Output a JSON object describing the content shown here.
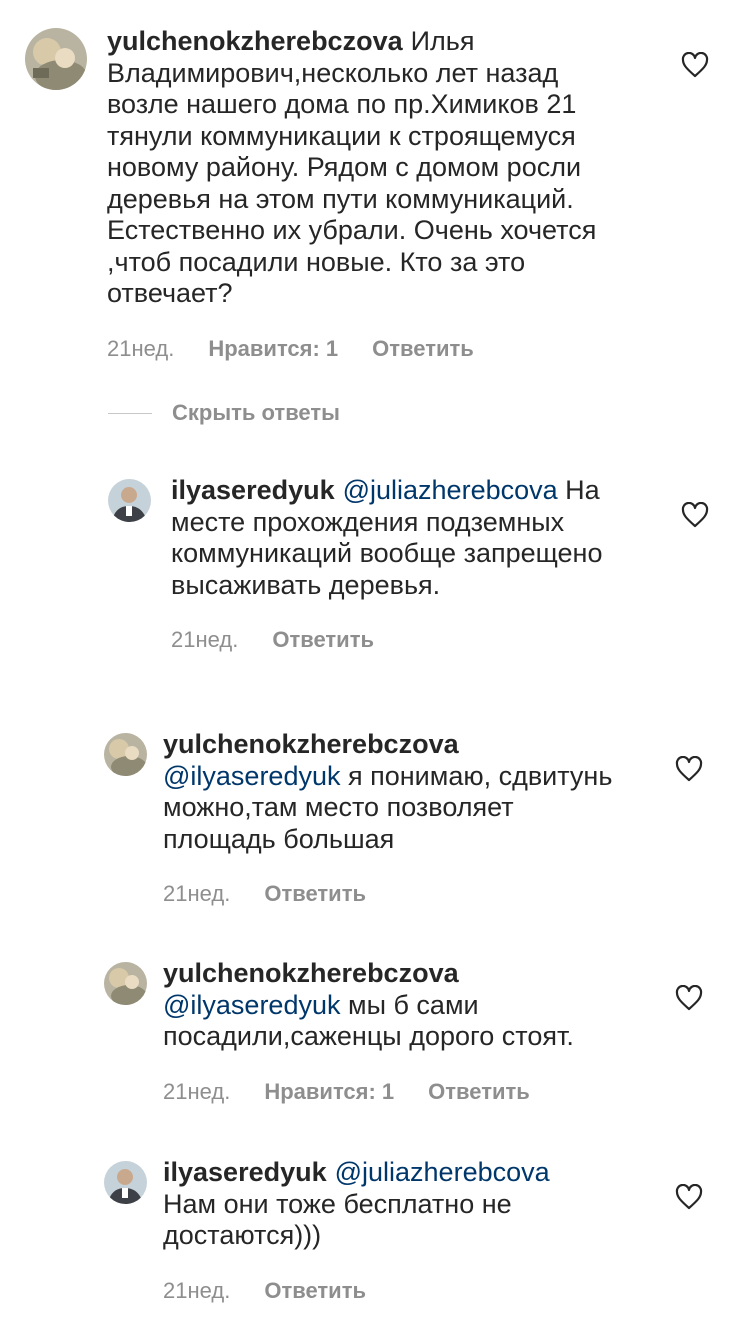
{
  "comment": {
    "username": "yulchenokzherebczova",
    "text": "Илья Владимирович,несколько лет назад возле нашего дома по пр.Химиков 21 тянули коммуникации к строящемуся новому району. Рядом с домом росли деревья на этом пути коммуникаций. Естественно их убрали. Очень хочется ,чтоб посадили новые. Кто за это отвечает?",
    "time": "21нед.",
    "likes": "Нравится: 1",
    "reply": "Ответить"
  },
  "hide_replies_label": "Скрыть ответы",
  "replies": [
    {
      "username": "ilyaseredyuk",
      "mention": "@juliazherebcova",
      "text": "На месте прохождения подземных коммуникаций вообще запрещено высаживать деревья.",
      "time": "21нед.",
      "likes": "",
      "reply": "Ответить"
    },
    {
      "username": "yulchenokzherebczova",
      "mention": "@ilyaseredyuk",
      "text": "я понимаю, сдвитунь можно,там место позволяет площадь большая",
      "time": "21нед.",
      "likes": "",
      "reply": "Ответить"
    },
    {
      "username": "yulchenokzherebczova",
      "mention": "@ilyaseredyuk",
      "text": "мы б сами посадили,саженцы дорого стоят.",
      "time": "21нед.",
      "likes": "Нравится: 1",
      "reply": "Ответить"
    },
    {
      "username": "ilyaseredyuk",
      "mention": "@juliazherebcova",
      "text": "Нам они тоже бесплатно не достаются)))",
      "time": "21нед.",
      "likes": "",
      "reply": "Ответить"
    }
  ],
  "icons": {
    "like": "heart-outline-icon",
    "avatar_a": "avatar-photo-woman",
    "avatar_b": "avatar-photo-man"
  },
  "colors": {
    "text": "#262626",
    "meta": "#8e8e8e",
    "mention": "#00376b"
  }
}
